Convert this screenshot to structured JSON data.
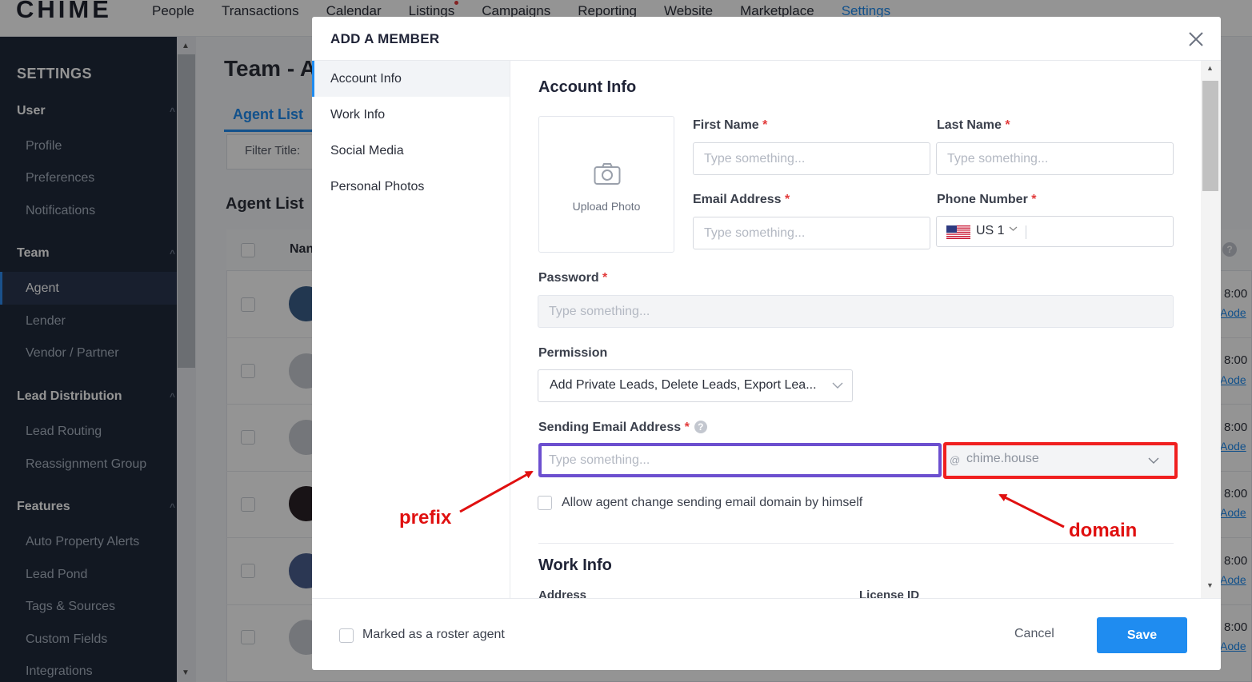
{
  "app": {
    "logo": "CHIME",
    "nav": [
      "People",
      "Transactions",
      "Calendar",
      "Listings",
      "Campaigns",
      "Reporting",
      "Website",
      "Marketplace",
      "Settings"
    ],
    "active_nav": "Settings",
    "accent_color": "#1f8cf0"
  },
  "sidebar": {
    "title": "SETTINGS",
    "sections": {
      "user": "User",
      "team": "Team",
      "lead_distribution": "Lead Distribution",
      "features": "Features"
    },
    "items": {
      "profile": "Profile",
      "preferences": "Preferences",
      "notifications": "Notifications",
      "agent": "Agent",
      "lender": "Lender",
      "vendor_partner": "Vendor / Partner",
      "lead_routing": "Lead Routing",
      "reassignment_group": "Reassignment Group",
      "auto_property_alerts": "Auto Property Alerts",
      "lead_pond": "Lead Pond",
      "tags_sources": "Tags & Sources",
      "custom_fields": "Custom Fields",
      "integrations": "Integrations"
    }
  },
  "background_page": {
    "title": "Team - A",
    "tab": "Agent List",
    "filter_title": "Filter Title:",
    "list_title": "Agent List",
    "column_name": "Nan",
    "times": [
      "8:00",
      "8:00",
      "8:00",
      "8:00",
      "8:00",
      "8:00"
    ],
    "links": [
      "Aode",
      "Aode",
      "Aode",
      "Aode",
      "Aode",
      "Aode"
    ]
  },
  "modal": {
    "title": "ADD A MEMBER",
    "left_nav": [
      "Account Info",
      "Work Info",
      "Social Media",
      "Personal Photos"
    ],
    "account_info": {
      "section_title": "Account Info",
      "upload_photo": "Upload Photo",
      "first_name_label": "First Name",
      "last_name_label": "Last Name",
      "email_label": "Email Address",
      "phone_label": "Phone Number",
      "phone_country": "US 1",
      "password_label": "Password",
      "permission_label": "Permission",
      "permission_value": "Add Private Leads, Delete Leads, Export Lea...",
      "sending_email_label": "Sending Email Address",
      "domain_at": "@",
      "domain_value": "chime.house",
      "allow_domain_change": "Allow agent change sending email domain by himself",
      "placeholder": "Type something...",
      "required_mark": "*"
    },
    "work_info": {
      "section_title": "Work Info",
      "address_label": "Address",
      "license_label": "License ID"
    },
    "footer": {
      "roster_agent": "Marked as a roster agent",
      "cancel": "Cancel",
      "save": "Save"
    }
  },
  "annotations": {
    "prefix": "prefix",
    "domain": "domain",
    "prefix_color": "#6c4fcf",
    "domain_color": "#f01f1f"
  }
}
